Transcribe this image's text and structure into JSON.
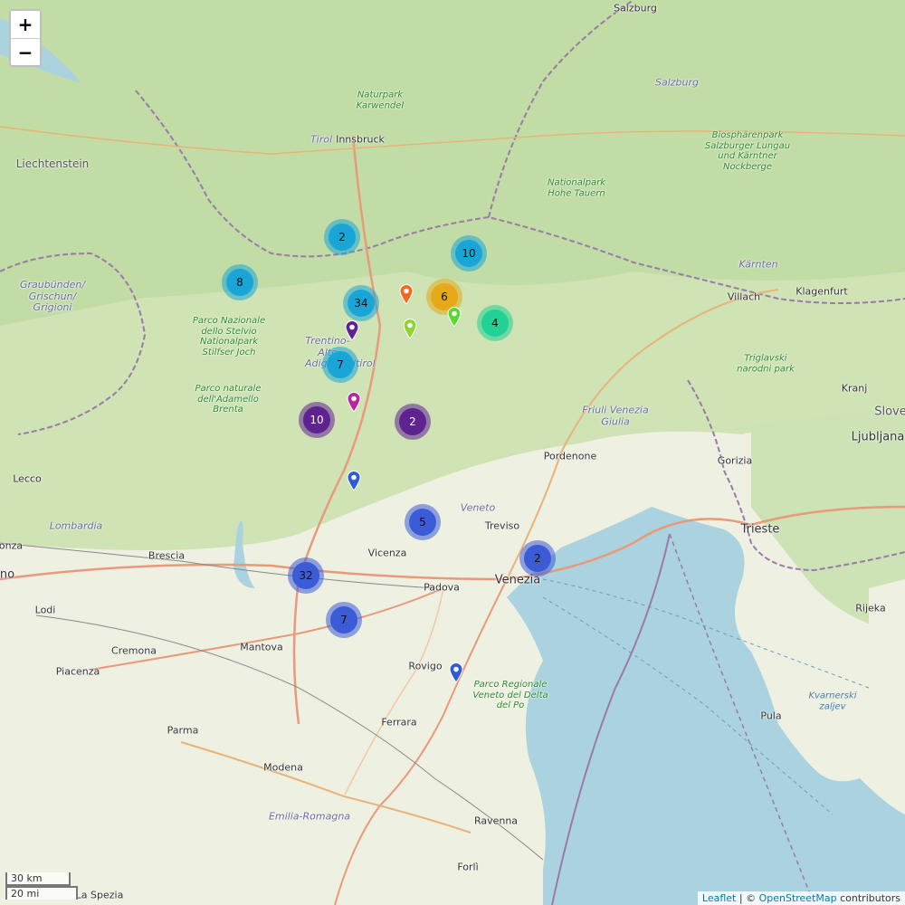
{
  "map": {
    "zoom_in": "+",
    "zoom_out": "−",
    "scale_km": "30 km",
    "scale_mi": "20 mi",
    "attribution": {
      "leaflet": "Leaflet",
      "sep": " | © ",
      "osm": "OpenStreetMap",
      "contributors": " contributors"
    },
    "labels": {
      "salzburg_top": "Salzburg",
      "salzburg_region": "Salzburg",
      "naturpark_karwendel": "Naturpark Karwendel",
      "tirol": "Tirol",
      "innsbruck": "Innsbruck",
      "liechtenstein": "Liechtenstein",
      "biosphaerenpark": "Biosphärenpark Salzburger Lungau und Kärntner Nockberge",
      "nationalpark_hohe_tauern": "Nationalpark Hohe Tauern",
      "kaernten": "Kärnten",
      "graubuenden": "Graubünden/ Grischun/ Grigioni",
      "parco_stelvio": "Parco Nazionale dello Stelvio Nationalpark Stilfser Joch",
      "trentino": "Trentino-Alto Adige/Südtirol",
      "parco_adamello": "Parco naturale dell'Adamello Brenta",
      "villach": "Villach",
      "klagenfurt": "Klagenfurt",
      "triglavski": "Triglavski narodni park",
      "kranj": "Kranj",
      "slovenija": "Slove",
      "ljubljana": "Ljubljana",
      "friuli": "Friuli Venezia Giulia",
      "pordenone": "Pordenone",
      "gorizia": "Gorizia",
      "trieste": "Trieste",
      "lecco": "Lecco",
      "lombardia": "Lombardia",
      "brescia": "Brescia",
      "monza": "onza",
      "milano": "no",
      "veneto": "Veneto",
      "treviso": "Treviso",
      "vicenza": "Vicenza",
      "venezia": "Venezia",
      "padova": "Padova",
      "lodi": "Lodi",
      "cremona": "Cremona",
      "mantova": "Mantova",
      "piacenza": "Piacenza",
      "rovigo": "Rovigo",
      "parco_delta_po": "Parco Regionale Veneto del Delta del Po",
      "ferrara": "Ferrara",
      "parma": "Parma",
      "modena": "Modena",
      "emilia_romagna": "Emilia-Romagna",
      "ravenna": "Ravenna",
      "forli": "Forlì",
      "la_spezia": "La Spezia",
      "rijeka": "Rijeka",
      "pula": "Pula",
      "kvarnerski": "Kvarnerski zaljev"
    },
    "clusters": [
      {
        "count": "2",
        "color": "#19a5d6",
        "dark": false
      },
      {
        "count": "10",
        "color": "#19a5d6",
        "dark": false
      },
      {
        "count": "8",
        "color": "#19a5d6",
        "dark": false
      },
      {
        "count": "34",
        "color": "#19a5d6",
        "dark": false
      },
      {
        "count": "6",
        "color": "#e6a919",
        "dark": false
      },
      {
        "count": "4",
        "color": "#22d196",
        "dark": false
      },
      {
        "count": "7",
        "color": "#19a5d6",
        "dark": false
      },
      {
        "count": "10",
        "color": "#5e2391",
        "dark": true
      },
      {
        "count": "2",
        "color": "#5e2391",
        "dark": true
      },
      {
        "count": "5",
        "color": "#3c5bd6",
        "dark": false
      },
      {
        "count": "2",
        "color": "#3c5bd6",
        "dark": false
      },
      {
        "count": "32",
        "color": "#3c5bd6",
        "dark": false
      },
      {
        "count": "7",
        "color": "#3c5bd6",
        "dark": false
      }
    ],
    "pins": [
      {
        "color": "#f26a1f"
      },
      {
        "color": "#5e2391"
      },
      {
        "color": "#8fd632"
      },
      {
        "color": "#5bd632"
      },
      {
        "color": "#b8269e"
      },
      {
        "color": "#2f5bd6"
      },
      {
        "color": "#2f5bd6"
      }
    ]
  }
}
